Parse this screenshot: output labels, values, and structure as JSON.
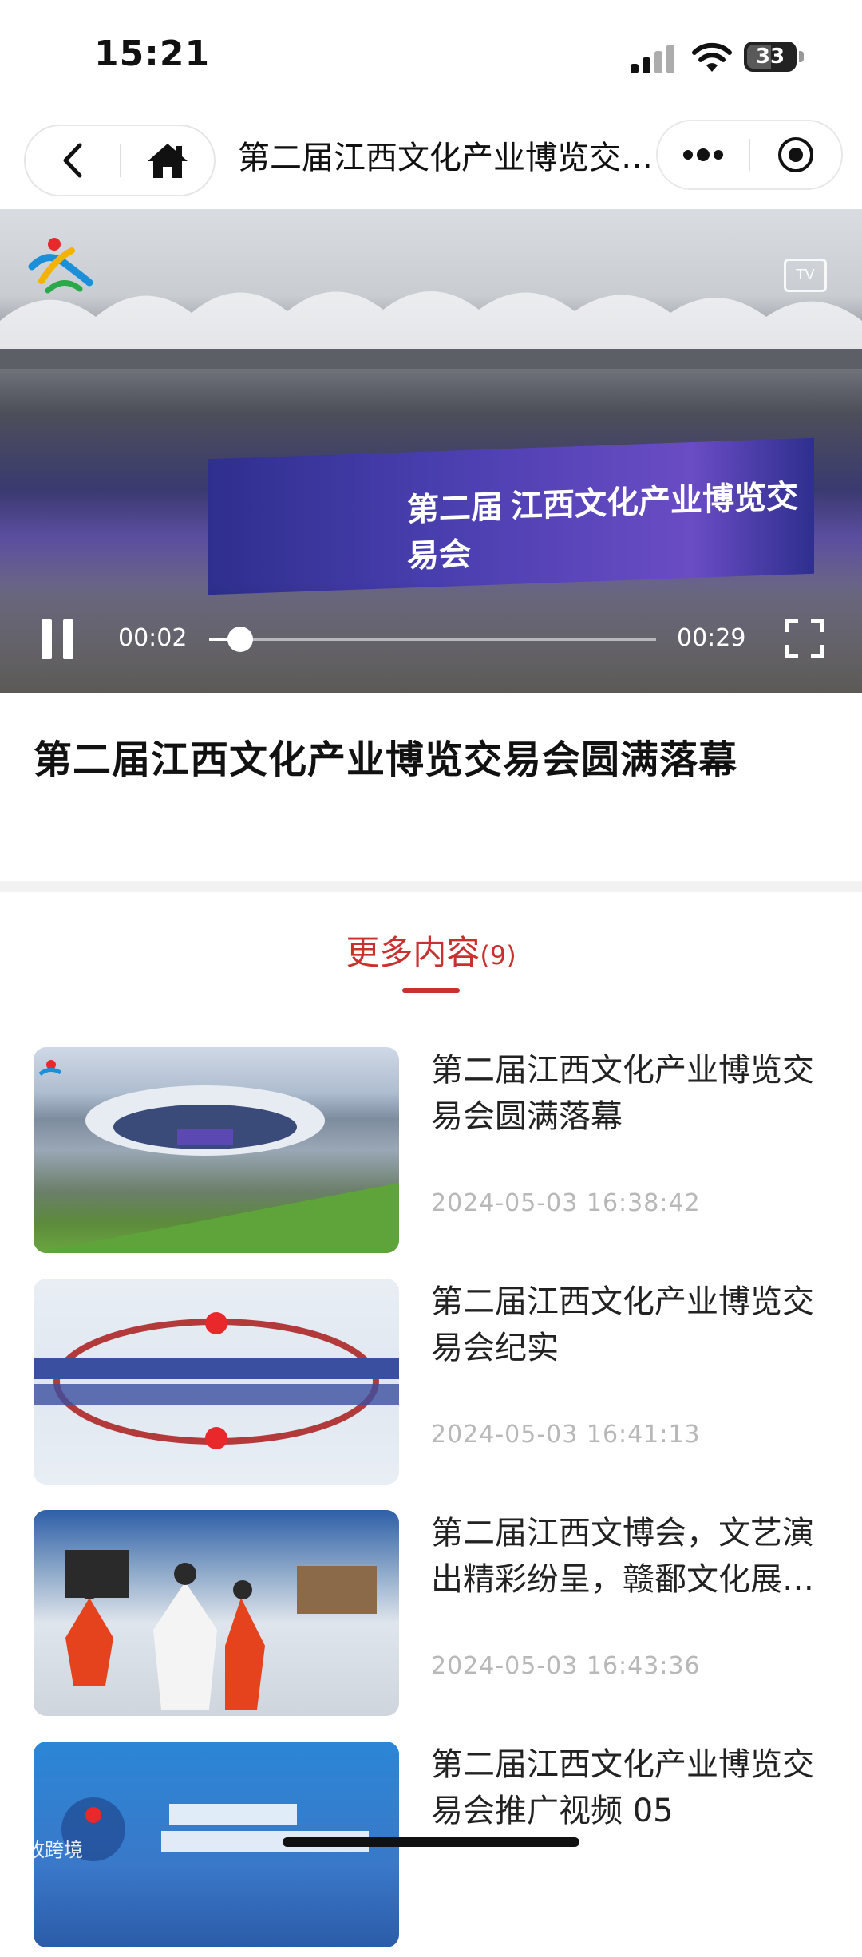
{
  "status_bar": {
    "time": "15:21",
    "battery": "33"
  },
  "nav": {
    "title": "第二届江西文化产业博览交易会圆满落幕"
  },
  "video": {
    "current_time": "00:02",
    "total_time": "00:29",
    "progress": 0.07,
    "banner_text": "第二届 江西文化产业博览交易会",
    "tv_badge": "TV"
  },
  "article": {
    "title": "第二届江西文化产业博览交易会圆满落幕"
  },
  "more": {
    "label": "更多内容",
    "count": "(9)"
  },
  "items": [
    {
      "title": "第二届江西文化产业博览交易会圆满落幕",
      "date": "2024-05-03 16:38:42"
    },
    {
      "title": "第二届江西文化产业博览交易会纪实",
      "date": "2024-05-03 16:41:13"
    },
    {
      "title": "第二届江西文博会，文艺演出精彩纷呈，赣鄱文化展…",
      "date": "2024-05-03 16:43:36"
    },
    {
      "title": "第二届江西文化产业博览交易会推广视频 05",
      "date": ""
    }
  ],
  "watermark": "大敗跨境",
  "colors": {
    "accent": "#c8312d",
    "date": "#b8b8b8",
    "band": "#f2f2f2"
  }
}
